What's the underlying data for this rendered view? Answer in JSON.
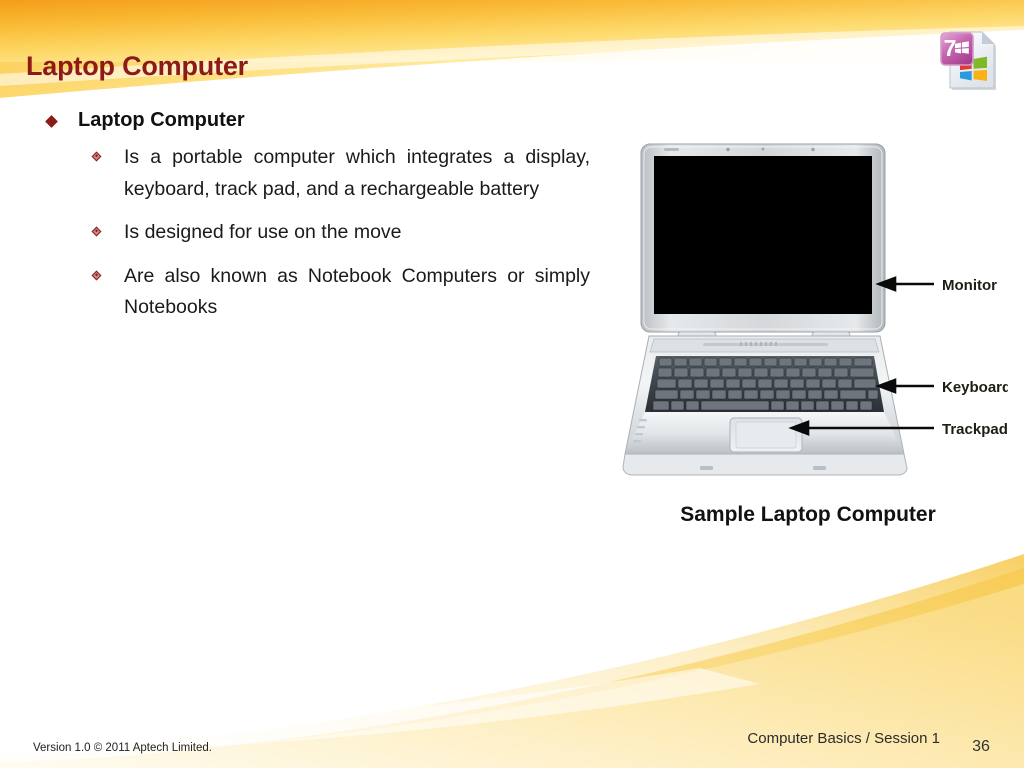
{
  "slide": {
    "title": "Laptop Computer",
    "logo_icon": "windows7-document-icon",
    "logo_badge_number": "7"
  },
  "content": {
    "bullets": [
      {
        "level": 1,
        "text": "Laptop Computer",
        "bullet_icon": "filled-diamond-bullet"
      },
      {
        "level": 2,
        "text": "Is a portable computer which integrates a display, keyboard, track pad, and a rechargeable battery",
        "bullet_icon": "outlined-diamond-bullet"
      },
      {
        "level": 2,
        "text": "Is designed for use on the move",
        "bullet_icon": "outlined-diamond-bullet"
      },
      {
        "level": 2,
        "text": "Are also known as Notebook Computers or simply Notebooks",
        "bullet_icon": "outlined-diamond-bullet"
      }
    ]
  },
  "figure": {
    "caption": "Sample Laptop Computer",
    "image_alt": "laptop-computer-photo",
    "callouts": [
      {
        "label": "Monitor",
        "arrow": "left-arrow"
      },
      {
        "label": "Keyboard",
        "arrow": "left-arrow"
      },
      {
        "label": "Trackpad",
        "arrow": "left-arrow"
      }
    ]
  },
  "footer": {
    "copyright": "Version 1.0 © 2011 Aptech Limited.",
    "course": "Computer Basics / Session 1",
    "page_number": "36"
  },
  "colors": {
    "title": "#8C1A17",
    "bullet": "#8C1A17",
    "header_gradient_start": "#F6A623",
    "header_gradient_end": "#FFE9A0",
    "footer_gradient": "#F7D070",
    "screen": "#000000",
    "laptop_body": "#D8DADC"
  }
}
